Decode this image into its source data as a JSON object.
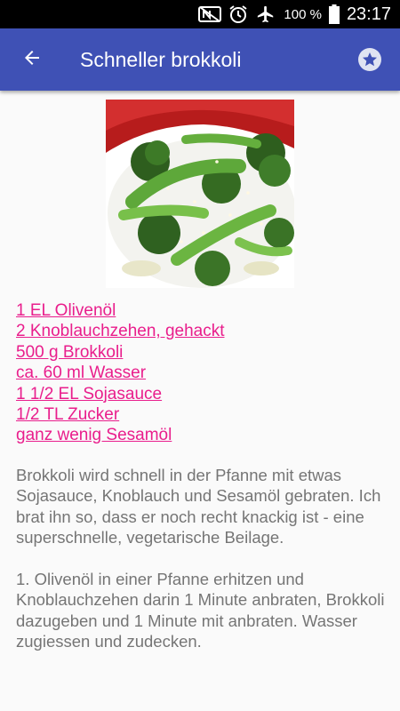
{
  "status_bar": {
    "battery_percent": "100 %",
    "time": "23:17",
    "icons": [
      "nfc-icon",
      "alarm-icon",
      "airplane-mode-icon",
      "battery-icon"
    ]
  },
  "app_bar": {
    "title": "Schneller brokkoli",
    "back_icon": "arrow-left-icon",
    "favorite_icon": "star-icon"
  },
  "recipe": {
    "image_alt": "Broccoli and snow peas with sesame",
    "ingredients": [
      "1 EL Olivenöl",
      "2 Knoblauchzehen, gehackt",
      "500 g Brokkoli",
      "ca. 60 ml Wasser",
      "1 1/2 EL Sojasauce",
      "1/2 TL Zucker",
      "ganz wenig Sesamöl"
    ],
    "description": "Brokkoli wird schnell in der Pfanne mit etwas Sojasauce, Knoblauch und Sesamöl gebraten. Ich brat ihn so, dass er noch recht knackig ist - eine superschnelle, vegetarische Beilage.",
    "step_1": "1. Olivenöl in einer Pfanne erhitzen und Knoblauchzehen darin 1 Minute anbraten, Brokkoli dazugeben und 1 Minute mit anbraten. Wasser zugiessen und zudecken."
  },
  "colors": {
    "app_bar": "#3f51b5",
    "link": "#e91e8c",
    "body_text": "#757575"
  }
}
